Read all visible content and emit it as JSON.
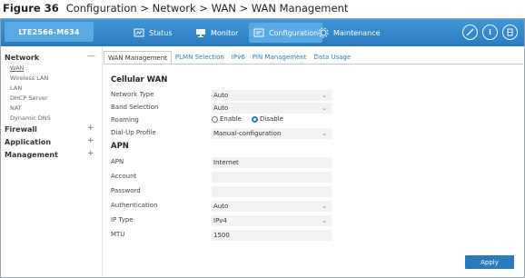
{
  "caption": {
    "figure": "Figure 36",
    "path": "Configuration > Network > WAN > WAN Management"
  },
  "header": {
    "brand": "LTE2566-M634",
    "nav": [
      {
        "label": "Status",
        "icon": "status-icon"
      },
      {
        "label": "Monitor",
        "icon": "monitor-icon"
      },
      {
        "label": "Configuration",
        "icon": "configuration-icon"
      },
      {
        "label": "Maintenance",
        "icon": "maintenance-icon"
      }
    ],
    "right_icons": [
      "wizard-icon",
      "info-icon",
      "logout-icon"
    ]
  },
  "sidebar": {
    "sections": [
      {
        "label": "Network",
        "sign": "—",
        "items": [
          "WAN",
          "Wireless LAN",
          "LAN",
          "DHCP Server",
          "NAT",
          "Dynamic DNS"
        ]
      },
      {
        "label": "Firewall",
        "sign": "+"
      },
      {
        "label": "Application",
        "sign": "+"
      },
      {
        "label": "Management",
        "sign": "+"
      }
    ]
  },
  "tabs": [
    "WAN Management",
    "PLMN Selection",
    "IPv6",
    "PIN Management",
    "Data Usage"
  ],
  "cellular": {
    "heading": "Cellular WAN",
    "network_type": {
      "label": "Network Type",
      "value": "Auto"
    },
    "band_selection": {
      "label": "Band Selection",
      "value": "Auto"
    },
    "roaming": {
      "label": "Roaming",
      "enable": "Enable",
      "disable": "Disable"
    },
    "dialup_profile": {
      "label": "Dial-Up Profile",
      "value": "Manual-configuration"
    }
  },
  "apn": {
    "heading": "APN",
    "apn": {
      "label": "APN",
      "value": "Internet"
    },
    "account": {
      "label": "Account",
      "value": ""
    },
    "password": {
      "label": "Password",
      "value": ""
    },
    "authentication": {
      "label": "Authentication",
      "value": "Auto"
    },
    "ip_type": {
      "label": "IP Type",
      "value": "IPv4"
    },
    "mtu": {
      "label": "MTU",
      "value": "1500"
    }
  },
  "apply_label": "Apply",
  "colors": {
    "header": "#2a79bd",
    "active": "#5aa9e2",
    "link": "#2a7fc4"
  }
}
